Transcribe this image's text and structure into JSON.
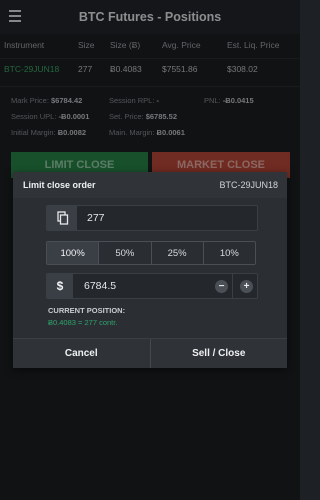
{
  "header": {
    "title": "BTC Futures - Positions"
  },
  "table": {
    "columns": [
      "Instrument",
      "Size",
      "Size (Ƀ)",
      "Avg. Price",
      "Est. Liq. Price"
    ],
    "row": {
      "instrument": "BTC-29JUN18",
      "size": "277",
      "size_btc": "Ƀ0.4083",
      "avg_price": "$7551.86",
      "liq_price": "$308.02"
    }
  },
  "stats": {
    "mark_price_label": "Mark Price:",
    "mark_price": "$6784.42",
    "session_rpl_label": "Session RPL:",
    "session_rpl": "-",
    "pnl_label": "PNL:",
    "pnl": "-Ƀ0.0415",
    "session_upl_label": "Session UPL:",
    "session_upl": "-Ƀ0.0001",
    "set_price_label": "Set. Price:",
    "set_price": "$6785.52",
    "initial_margin_label": "Initial Margin:",
    "initial_margin": "Ƀ0.0082",
    "main_margin_label": "Main. Margin:",
    "main_margin": "Ƀ0.0061"
  },
  "actions": {
    "limit_close": "LIMIT CLOSE",
    "market_close": "MARKET CLOSE"
  },
  "modal": {
    "title": "Limit close order",
    "instrument": "BTC-29JUN18",
    "quantity": "277",
    "percents": [
      "100%",
      "50%",
      "25%",
      "10%"
    ],
    "active_percent": "100%",
    "currency_symbol": "$",
    "price": "6784.5",
    "minus": "−",
    "plus": "+",
    "current_position_label": "CURRENT POSITION:",
    "current_position_value": "Ƀ0.4083 = 277 contr.",
    "cancel": "Cancel",
    "sell_close": "Sell / Close"
  },
  "colors": {
    "green": "#2ea36a",
    "red": "#c14a3c",
    "background": "#1d2024"
  },
  "icons": {
    "menu": "hamburger-menu-icon",
    "copy": "copy-icon"
  }
}
